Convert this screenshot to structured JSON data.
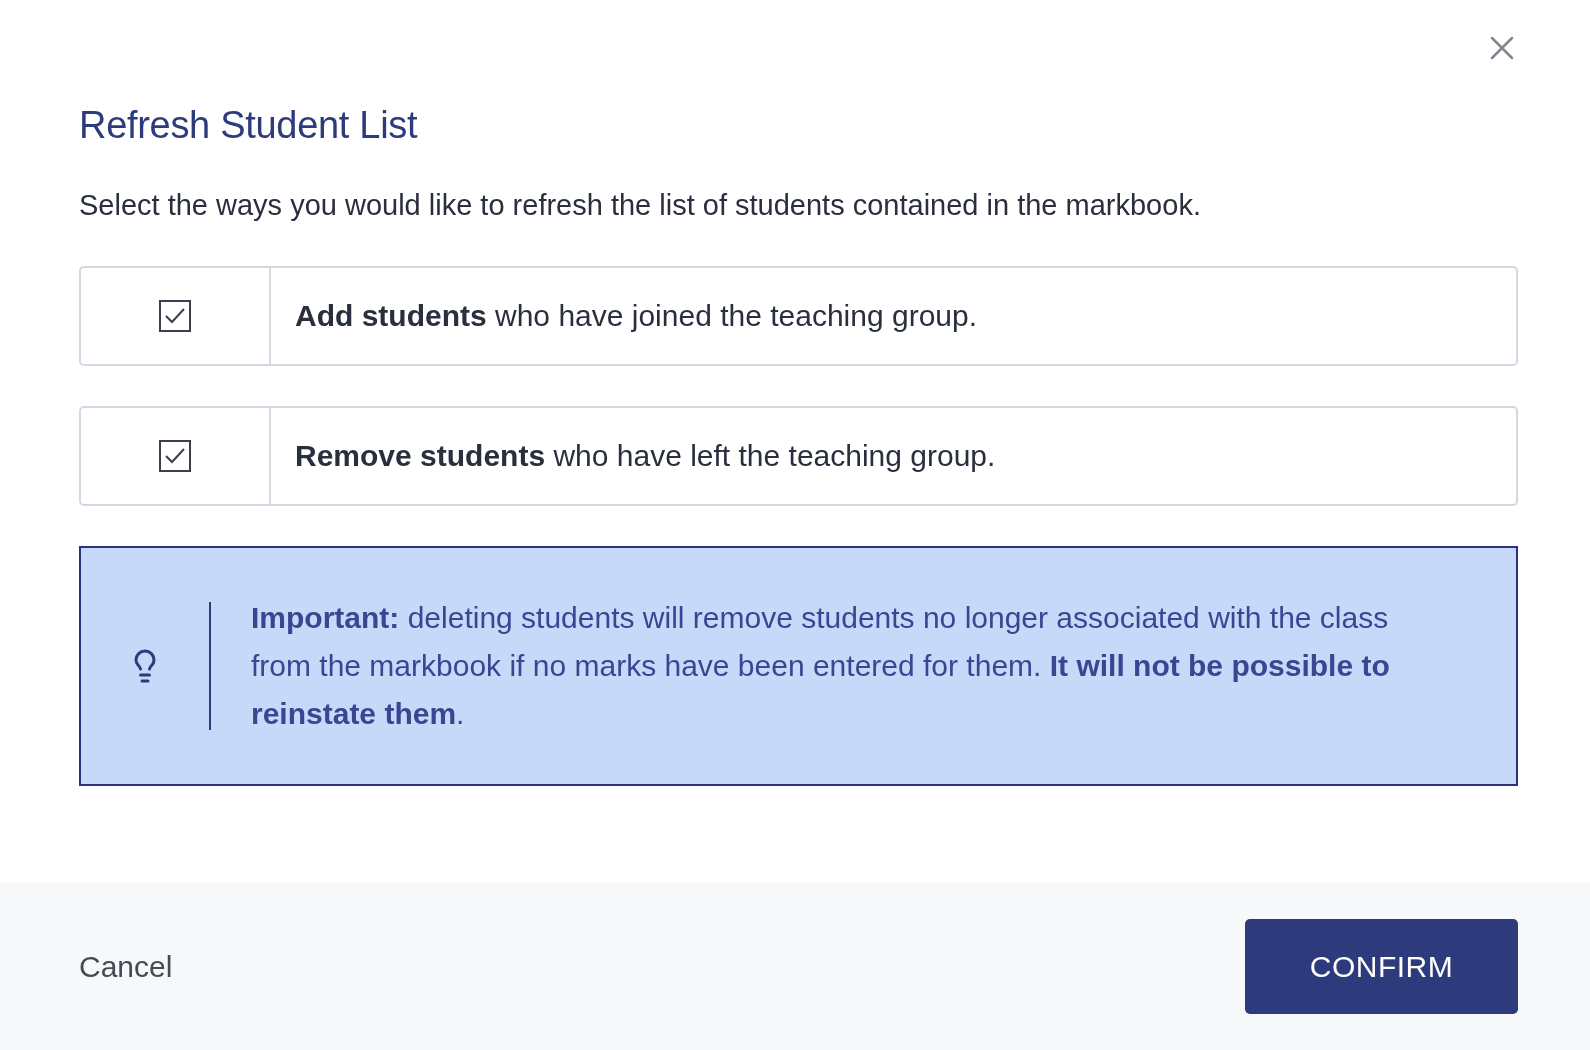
{
  "dialog": {
    "title": "Refresh Student List",
    "description": "Select the ways you would like to refresh the list of students contained in the markbook.",
    "options": [
      {
        "text": "**Add students** who have joined the teaching group.",
        "checked": true
      },
      {
        "text": "**Remove students** who have left the teaching group.",
        "checked": true
      }
    ],
    "notice": {
      "text": "**Important:** deleting students will remove students no longer associated with the class from the markbook if no marks have been entered for them. **It will not be possible to reinstate them**."
    },
    "footer": {
      "cancel": "Cancel",
      "confirm": "CONFIRM"
    }
  }
}
